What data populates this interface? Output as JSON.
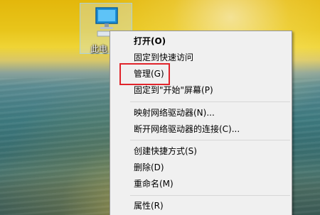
{
  "desktop": {
    "icon_label": "此电"
  },
  "context_menu": {
    "items": [
      {
        "label": "打开(O)",
        "bold": true
      },
      {
        "label": "固定到快速访问"
      },
      {
        "label": "管理(G)"
      },
      {
        "label": "固定到\"开始\"屏幕(P)"
      },
      {
        "label": "映射网络驱动器(N)..."
      },
      {
        "label": "断开网络驱动器的连接(C)..."
      },
      {
        "label": "创建快捷方式(S)"
      },
      {
        "label": "删除(D)"
      },
      {
        "label": "重命名(M)"
      },
      {
        "label": "属性(R)"
      }
    ]
  },
  "annotation": {
    "highlight_color": "#e0242b",
    "highlighted_item": "管理(G)"
  }
}
